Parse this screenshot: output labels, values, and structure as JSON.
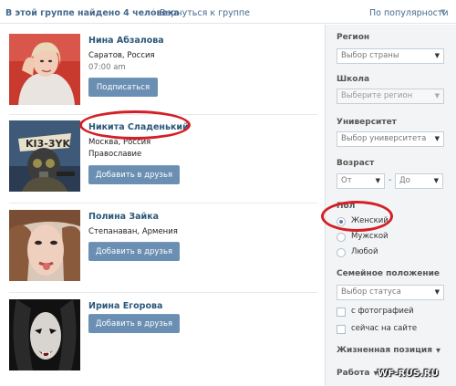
{
  "header": {
    "count_text": "В этой группе найдено 4 человека",
    "separator": "|",
    "back_link": "Вернуться к группе",
    "sort_label": "По популярности"
  },
  "people": [
    {
      "name": "Нина Абзалова",
      "location": "Саратов, Россия",
      "extra": "07:00 am",
      "button": "Подписаться"
    },
    {
      "name": "Никита Сладенький",
      "location": "Москва, Россия",
      "extra": "Православие",
      "button": "Добавить в друзья"
    },
    {
      "name": "Полина Зайка",
      "location": "Степанаван, Армения",
      "extra": "",
      "button": "Добавить в друзья"
    },
    {
      "name": "Ирина Егорова",
      "location": "",
      "extra": "",
      "button": "Добавить в друзья"
    }
  ],
  "filters": {
    "region_label": "Регион",
    "region_value": "Выбор страны",
    "school_label": "Школа",
    "school_value": "Выберите регион",
    "university_label": "Университет",
    "university_value": "Выбор университета",
    "age_label": "Возраст",
    "age_from": "От",
    "age_dash": "-",
    "age_to": "До",
    "gender_label": "Пол",
    "gender_options": [
      "Женский",
      "Мужской",
      "Любой"
    ],
    "gender_selected": "Женский",
    "marital_label": "Семейное положение",
    "marital_value": "Выбор статуса",
    "with_photo": "с фотографией",
    "online_now": "сейчас на сайте",
    "life_position": "Жизненная позиция",
    "work": "Работа"
  },
  "watermark": "WF-RUS.RU",
  "colors": {
    "accent": "#45688e",
    "button": "#6a8fb2",
    "annotation": "#d41f26"
  }
}
